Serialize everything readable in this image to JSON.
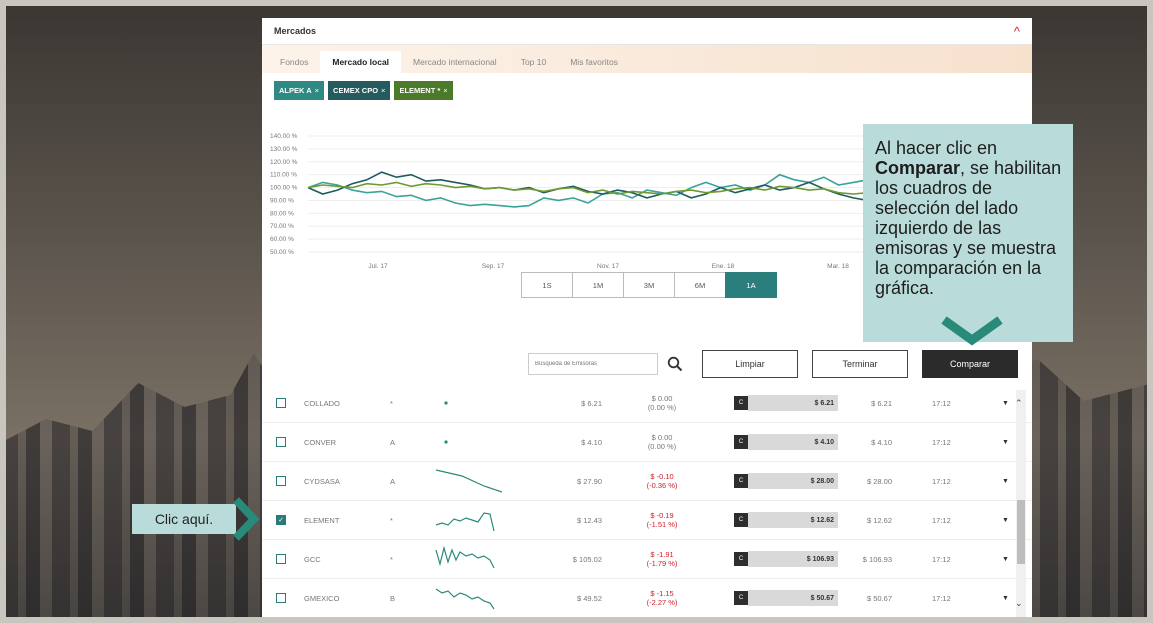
{
  "panel": {
    "title": "Mercados"
  },
  "tabs": [
    "Fondos",
    "Mercado local",
    "Mercado internacional",
    "Top 10",
    "Mis favoritos"
  ],
  "active_tab": "Mercado local",
  "chips": [
    {
      "label": "ALPEK A",
      "color": "#2f8a84"
    },
    {
      "label": "CEMEX CPO",
      "color": "#255a5e"
    },
    {
      "label": "ELEMENT *",
      "color": "#4b7a2a"
    }
  ],
  "chart_data": {
    "type": "line",
    "y_ticks": [
      "140.00 %",
      "130.00 %",
      "120.00 %",
      "110.00 %",
      "100.00 %",
      "90.00 %",
      "80.00 %",
      "70.00 %",
      "60.00 %",
      "50.00 %"
    ],
    "ylim": [
      50,
      140
    ],
    "x_ticks": [
      "Jul. 17",
      "Sep. 17",
      "Nov. 17",
      "Ene. 18",
      "Mar. 18"
    ],
    "grid": true,
    "series": [
      {
        "name": "ALPEK A",
        "color": "#3aa39a",
        "values": [
          100,
          104,
          102,
          98,
          96,
          97,
          93,
          94,
          90,
          92,
          88,
          86,
          87,
          86,
          85,
          86,
          92,
          90,
          92,
          88,
          95,
          96,
          92,
          98,
          96,
          94,
          100,
          104,
          100,
          102,
          98,
          102,
          110,
          106,
          104,
          108,
          102,
          104,
          106
        ]
      },
      {
        "name": "CEMEX CPO",
        "color": "#1f5a5e",
        "values": [
          100,
          95,
          98,
          103,
          106,
          112,
          108,
          110,
          105,
          106,
          104,
          102,
          99,
          100,
          98,
          100,
          96,
          99,
          101,
          97,
          95,
          98,
          96,
          92,
          95,
          97,
          92,
          95,
          100,
          96,
          99,
          102,
          98,
          100,
          104,
          99,
          95,
          92,
          90
        ]
      },
      {
        "name": "ELEMENT *",
        "color": "#6e9a32",
        "values": [
          100,
          102,
          101,
          100,
          103,
          102,
          104,
          101,
          103,
          102,
          100,
          101,
          99,
          100,
          98,
          99,
          97,
          99,
          100,
          96,
          98,
          95,
          97,
          96,
          95,
          97,
          98,
          96,
          97,
          99,
          100,
          98,
          101,
          100,
          98,
          99,
          96,
          95,
          96
        ]
      }
    ]
  },
  "ranges": [
    "1S",
    "1M",
    "3M",
    "6M",
    "1A"
  ],
  "active_range": "1A",
  "toolbar": {
    "search_placeholder": "Búsqueda de Emisoras",
    "clear_label": "Limpiar",
    "finish_label": "Terminar",
    "compare_label": "Comparar"
  },
  "rows": [
    {
      "name": "COLLADO",
      "serie": "*",
      "price": "$ 6.21",
      "change": "$ 0.00",
      "pct": "(0.00 %)",
      "neg": false,
      "c": "C",
      "bar": "$ 6.21",
      "ref": "$ 6.21",
      "time": "17:12",
      "checked": false,
      "spark": "dot"
    },
    {
      "name": "CONVER",
      "serie": "A",
      "price": "$ 4.10",
      "change": "$ 0.00",
      "pct": "(0.00 %)",
      "neg": false,
      "c": "C",
      "bar": "$ 4.10",
      "ref": "$ 4.10",
      "time": "17:12",
      "checked": false,
      "spark": "dot"
    },
    {
      "name": "CYDSASA",
      "serie": "A",
      "price": "$ 27.90",
      "change": "$ -0.10",
      "pct": "(-0.36 %)",
      "neg": true,
      "c": "C",
      "bar": "$ 28.00",
      "ref": "$ 28.00",
      "time": "17:12",
      "checked": false,
      "spark": "down"
    },
    {
      "name": "ELEMENT",
      "serie": "*",
      "price": "$ 12.43",
      "change": "$ -0.19",
      "pct": "(-1.51 %)",
      "neg": true,
      "c": "C",
      "bar": "$ 12.62",
      "ref": "$ 12.62",
      "time": "17:12",
      "checked": true,
      "spark": "wave1"
    },
    {
      "name": "GCC",
      "serie": "*",
      "price": "$ 105.02",
      "change": "$ -1.91",
      "pct": "(-1.79 %)",
      "neg": true,
      "c": "C",
      "bar": "$ 106.93",
      "ref": "$ 106.93",
      "time": "17:12",
      "checked": false,
      "spark": "wave2"
    },
    {
      "name": "GMEXICO",
      "serie": "B",
      "price": "$ 49.52",
      "change": "$ -1.15",
      "pct": "(-2.27 %)",
      "neg": true,
      "c": "C",
      "bar": "$ 50.67",
      "ref": "$ 50.67",
      "time": "17:12",
      "checked": false,
      "spark": "wave3"
    }
  ],
  "callout": {
    "pre": "Al hacer clic en ",
    "bold": "Comparar",
    "post": ", se habilitan los cuadros de selección del lado izquierdo de las emisoras y se muestra la comparación en la gráfica."
  },
  "click_label": "Clic aquí.",
  "icons": {
    "collapse": "chevron-up-icon",
    "search": "search-icon",
    "row_menu": "caret-down-icon",
    "chip_close": "close-icon"
  },
  "colors": {
    "accent": "#2c7e7d",
    "callout_bg": "#b9dcda",
    "arrow": "#2a8a7a",
    "negative": "#d0202a"
  }
}
